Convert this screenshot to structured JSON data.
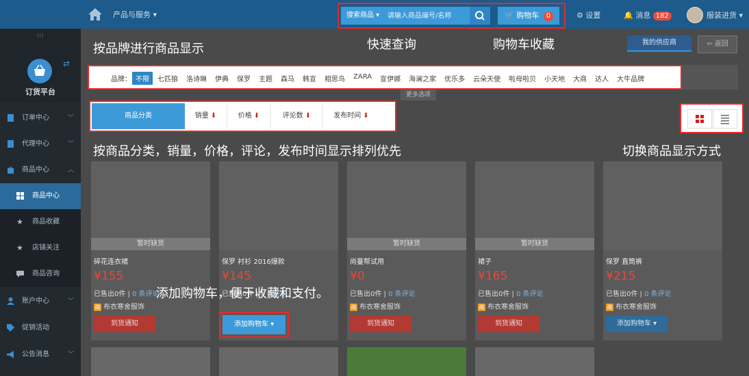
{
  "topbar": {
    "menu_label": "产品与服务 ▾",
    "search_category": "搜索商品 ▾",
    "search_placeholder": "请输入商品编号/名称",
    "cart_label": "购物车",
    "cart_count": "0",
    "settings_label": "设置",
    "messages_label": "消息",
    "messages_count": "182",
    "user_label": "服装进货 ▾"
  },
  "sidebar": {
    "grip": "III",
    "title": "订货平台",
    "items": [
      {
        "label": "订单中心",
        "icon": "file-icon"
      },
      {
        "label": "代理中心",
        "icon": "file-icon"
      },
      {
        "label": "商品中心",
        "icon": "bag-icon"
      },
      {
        "label": "商品中心",
        "icon": "grid-icon"
      },
      {
        "label": "商品收藏",
        "icon": "star-icon"
      },
      {
        "label": "店铺关注",
        "icon": "star-icon"
      },
      {
        "label": "商品咨询",
        "icon": "chat-icon"
      },
      {
        "label": "账户中心",
        "icon": "user-icon"
      },
      {
        "label": "促销活动",
        "icon": "tag-icon"
      },
      {
        "label": "公告消息",
        "icon": "megaphone-icon"
      }
    ]
  },
  "annotations": {
    "brand": "按品牌进行商品显示",
    "search": "快速查询",
    "cart": "购物车收藏",
    "sort": "按商品分类，销量，价格，评论，发布时间显示排列优先",
    "view": "切换商品显示方式",
    "add_cart": "添加购物车，便于收藏和支付。"
  },
  "header_buttons": {
    "supplier": "我的供应商",
    "back": "返回"
  },
  "brands": {
    "label": "品牌：",
    "items": [
      "不限",
      "七匹狼",
      "洛诗琳",
      "伊典",
      "保罗",
      "主题",
      "森马",
      "韩宣",
      "相思鸟",
      "ZARA",
      "宣伊娜",
      "海澜之家",
      "优乐多",
      "云朵天使",
      "啦母啦贝",
      "小天地",
      "大商",
      "达人",
      "大牛品牌"
    ],
    "more": "更多选项"
  },
  "sort": {
    "category": "商品分类",
    "items": [
      "销量",
      "价格",
      "评论数",
      "发布时间"
    ]
  },
  "products": [
    {
      "status": "暂时缺货",
      "name": "碎花连衣裙",
      "price": "¥155",
      "sold": "已售出0件",
      "reviews": "0 条评论",
      "shop": "布衣寒舍服饰",
      "action": "到货通知"
    },
    {
      "status": "",
      "name": "保罗 衬衫 2016爆款",
      "price": "¥145",
      "sold": "已售出0件",
      "reviews": "0 条评论",
      "shop": "布衣寒舍服饰",
      "action": "添加购物车 ▾"
    },
    {
      "status": "暂时缺货",
      "name": "尚蔓帮试用",
      "price": "¥0",
      "sold": "已售出0件",
      "reviews": "0 条评论",
      "shop": "布衣寒舍服饰",
      "action": "到货通知"
    },
    {
      "status": "暂时缺货",
      "name": "裙子",
      "price": "¥165",
      "sold": "已售出0件",
      "reviews": "0 条评论",
      "shop": "布衣寒舍服饰",
      "action": "到货通知"
    },
    {
      "status": "",
      "name": "保罗 直筒裤",
      "price": "¥215",
      "sold": "已售出0件",
      "reviews": "0 条评论",
      "shop": "布衣寒舍服饰",
      "action": "添加购物车 ▾"
    }
  ]
}
